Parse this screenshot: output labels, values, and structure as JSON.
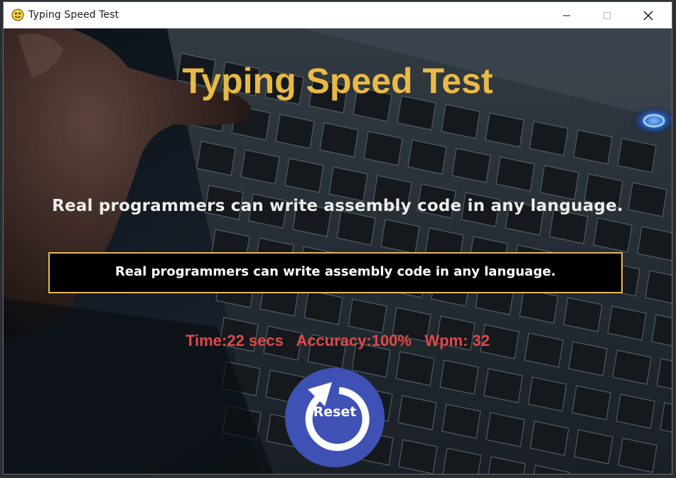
{
  "window": {
    "title": "Typing Speed Test"
  },
  "game": {
    "heading": "Typing Speed Test",
    "target_sentence": "Real programmers can write assembly code in any language.",
    "typed_text": "Real programmers can write assembly code in any language.",
    "stats": {
      "time": "Time:22 secs",
      "accuracy": "Accuracy:100%",
      "wpm": "Wpm: 32"
    },
    "reset_label": "Reset"
  },
  "colors": {
    "heading": "#f2c24a",
    "stats": "#e04848",
    "input_border": "#e6b95a",
    "reset_button": "#3f51b5"
  },
  "icons": {
    "app": "python-snake-icon",
    "reset": "refresh-arrow-icon"
  }
}
